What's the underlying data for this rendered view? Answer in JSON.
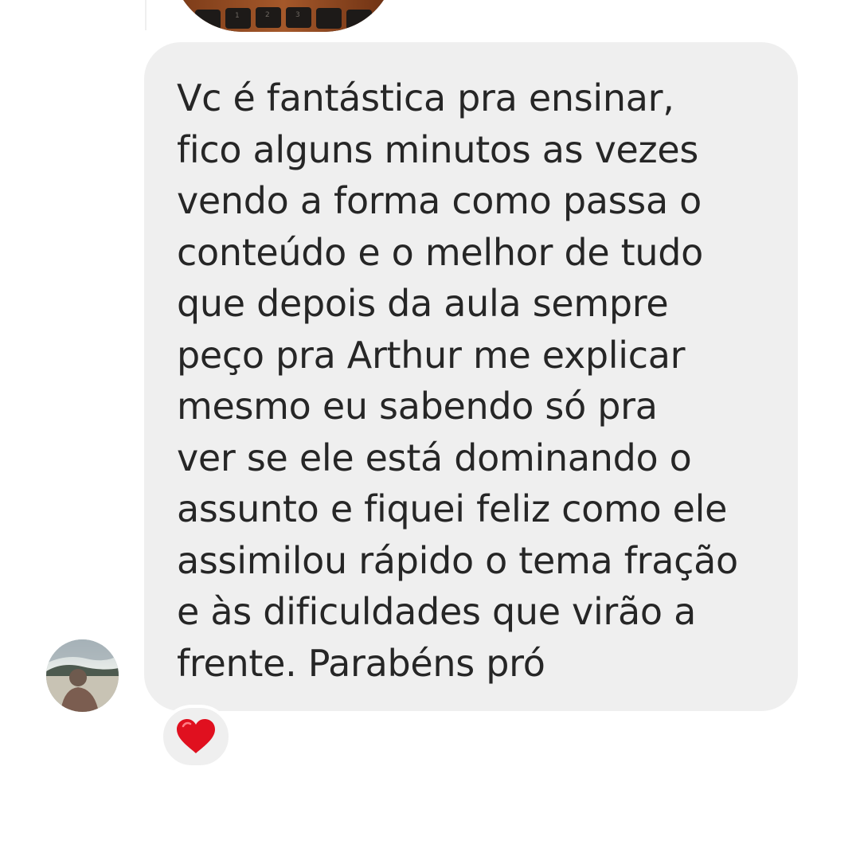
{
  "thread": {
    "previous_item": {
      "icon": "photo-thumbnail"
    },
    "message": {
      "text": "Vc é fantástica pra ensinar,\nfico alguns minutos as vezes\nvendo a forma como passa o\nconteúdo e o melhor de tudo\nque depois da aula sempre\npeço pra Arthur me explicar\nmesmo eu sabendo só pra\nver se ele está dominando o\nassunto e fiquei feliz como ele\nassimilou rápido o tema fração\ne às dificuldades que virão a\nfrente. Parabéns pró",
      "bubble_color": "#efefef",
      "text_color": "#262626"
    },
    "sender": {
      "avatar_icon": "profile-avatar"
    },
    "reaction": {
      "icon": "red-heart-icon",
      "color": "#e0101f"
    }
  }
}
